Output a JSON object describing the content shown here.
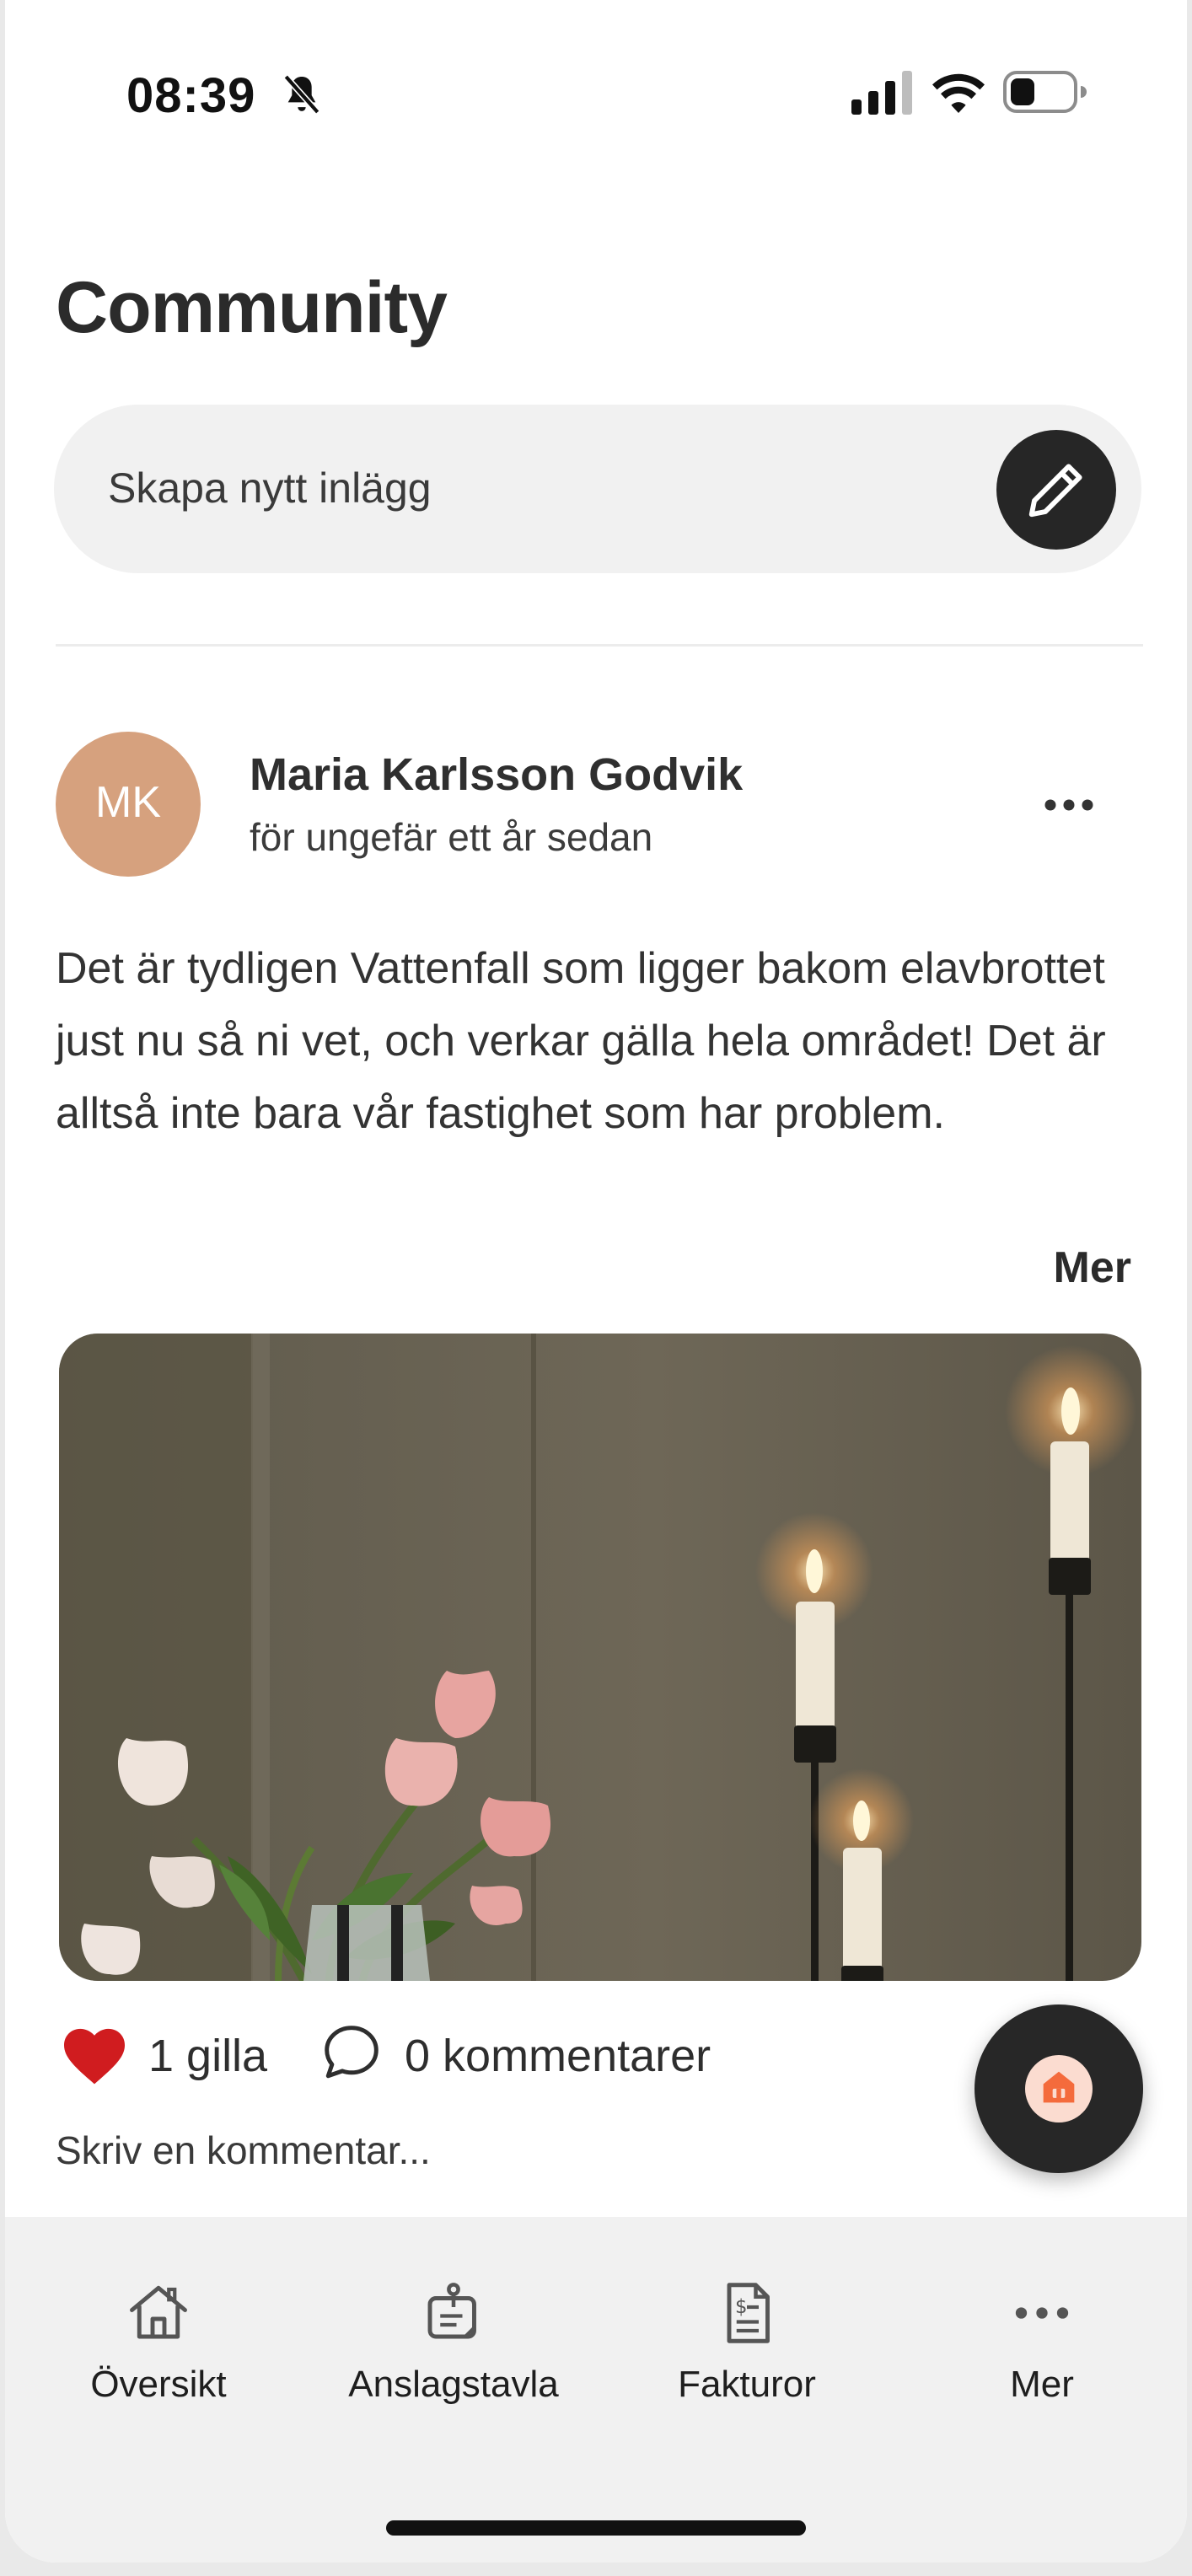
{
  "status_bar": {
    "time": "08:39",
    "icons": [
      "bell-slash-icon",
      "cellular-signal-icon",
      "wifi-icon",
      "battery-icon"
    ]
  },
  "header": {
    "title": "Community"
  },
  "composer": {
    "placeholder": "Skapa nytt inlägg",
    "button_icon": "pencil-icon"
  },
  "post": {
    "avatar_initials": "MK",
    "avatar_color": "#d6a17e",
    "author": "Maria Karlsson Godvik",
    "time": "för ungefär ett år sedan",
    "text": "Det är tydligen Vattenfall som ligger bakom elavbrottet just nu så ni vet, och verkar gälla hela området! Det är alltså inte bara vår fastighet som har problem.",
    "more_label": "Mer",
    "image_icon": "candles-and-tulips-photo",
    "likes_label": "1 gilla",
    "comments_label": "0 kommentarer",
    "comment_placeholder": "Skriv en kommentar..."
  },
  "fab": {
    "icon": "home-icon",
    "accent": "#f46b3c"
  },
  "tabbar": {
    "items": [
      {
        "label": "Översikt",
        "icon": "house-icon"
      },
      {
        "label": "Anslagstavla",
        "icon": "notice-board-icon"
      },
      {
        "label": "Fakturor",
        "icon": "invoice-icon"
      },
      {
        "label": "Mer",
        "icon": "more-dots-icon"
      }
    ]
  },
  "colors": {
    "heart": "#d01c1f",
    "dark_button": "#262626",
    "surface": "#f1f1f1"
  }
}
